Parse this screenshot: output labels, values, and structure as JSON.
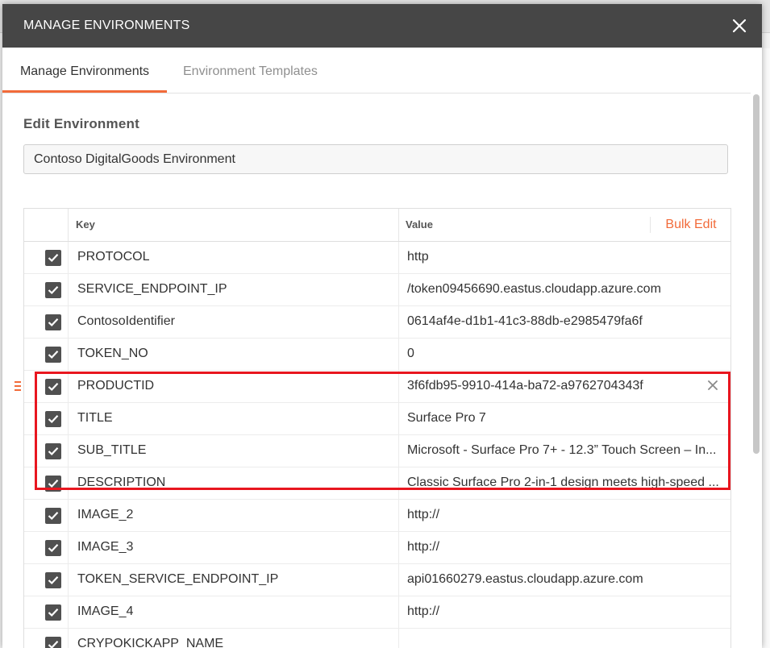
{
  "modal": {
    "title": "MANAGE ENVIRONMENTS",
    "close_icon": "close-icon"
  },
  "tabs": [
    {
      "label": "Manage Environments",
      "active": true
    },
    {
      "label": "Environment Templates",
      "active": false
    }
  ],
  "edit": {
    "section_title": "Edit Environment",
    "environment_name": "Contoso DigitalGoods Environment"
  },
  "table": {
    "header_key": "Key",
    "header_value": "Value",
    "bulk_edit_label": "Bulk Edit",
    "rows": [
      {
        "key": "PROTOCOL",
        "value": "http",
        "checked": true
      },
      {
        "key": "SERVICE_ENDPOINT_IP",
        "value": "/token09456690.eastus.cloudapp.azure.com",
        "checked": true
      },
      {
        "key": "ContosoIdentifier",
        "value": "0614af4e-d1b1-41c3-88db-e2985479fa6f",
        "checked": true
      },
      {
        "key": "TOKEN_NO",
        "value": "0",
        "checked": true
      },
      {
        "key": "PRODUCTID",
        "value": "3f6fdb95-9910-414a-ba72-a9762704343f",
        "checked": true
      },
      {
        "key": "TITLE",
        "value": "Surface Pro 7",
        "checked": true
      },
      {
        "key": "SUB_TITLE",
        "value": "Microsoft - Surface Pro 7+ - 12.3” Touch Screen – In...",
        "checked": true
      },
      {
        "key": "DESCRIPTION",
        "value": "Classic Surface Pro 2-in-1 design meets high-speed ...",
        "checked": true
      },
      {
        "key": "IMAGE_2",
        "value": "http://",
        "checked": true
      },
      {
        "key": "IMAGE_3",
        "value": "http://",
        "checked": true
      },
      {
        "key": "TOKEN_SERVICE_ENDPOINT_IP",
        "value": "api01660279.eastus.cloudapp.azure.com",
        "checked": true
      },
      {
        "key": "IMAGE_4",
        "value": "http://",
        "checked": true
      },
      {
        "key": "CRYPOKICKAPP_NAME",
        "value": "",
        "checked": true
      }
    ]
  },
  "colors": {
    "accent": "#f26b3a",
    "header_bg": "#464646",
    "highlight": "#e8161f"
  }
}
